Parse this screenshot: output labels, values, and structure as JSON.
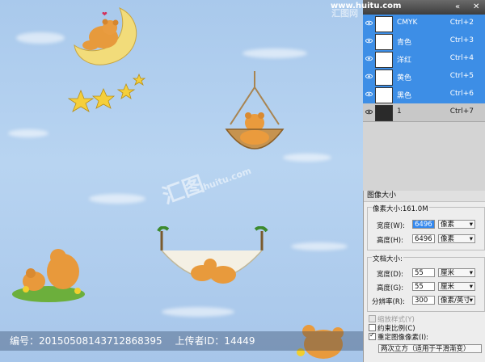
{
  "watermark": {
    "brand": "汇图网",
    "url": "www.huitu.com",
    "center_cn": "汇图",
    "center_url": "huitu.com"
  },
  "footer": {
    "id_label": "编号：20150508143712868395",
    "uploader_label": "上传者ID：14449"
  },
  "channels": [
    {
      "name": "CMYK",
      "shortcut": "Ctrl+2",
      "selected": true
    },
    {
      "name": "青色",
      "shortcut": "Ctrl+3",
      "selected": true
    },
    {
      "name": "洋红",
      "shortcut": "Ctrl+4",
      "selected": true
    },
    {
      "name": "黄色",
      "shortcut": "Ctrl+5",
      "selected": true
    },
    {
      "name": "黑色",
      "shortcut": "Ctrl+6",
      "selected": true
    },
    {
      "name": "1",
      "shortcut": "Ctrl+7",
      "selected": false
    }
  ],
  "dialog": {
    "title": "图像大小",
    "pixel_dims": "像素大小:161.0M",
    "width_label": "宽度(W):",
    "width_value": "6496",
    "width_unit": "像素",
    "height_label": "高度(H):",
    "height_value": "6496",
    "height_unit": "像素",
    "doc_size": "文档大小:",
    "doc_width_label": "宽度(D):",
    "doc_width_value": "55",
    "doc_width_unit": "厘米",
    "doc_height_label": "高度(G):",
    "doc_height_value": "55",
    "doc_height_unit": "厘米",
    "resolution_label": "分辨率(R):",
    "resolution_value": "300",
    "resolution_unit": "像素/英寸",
    "scale_styles": "缩放样式(Y)",
    "constrain": "约束比例(C)",
    "resample": "重定图像像素(I):",
    "resample_method": "两次立方（适用于平滑渐变）"
  }
}
